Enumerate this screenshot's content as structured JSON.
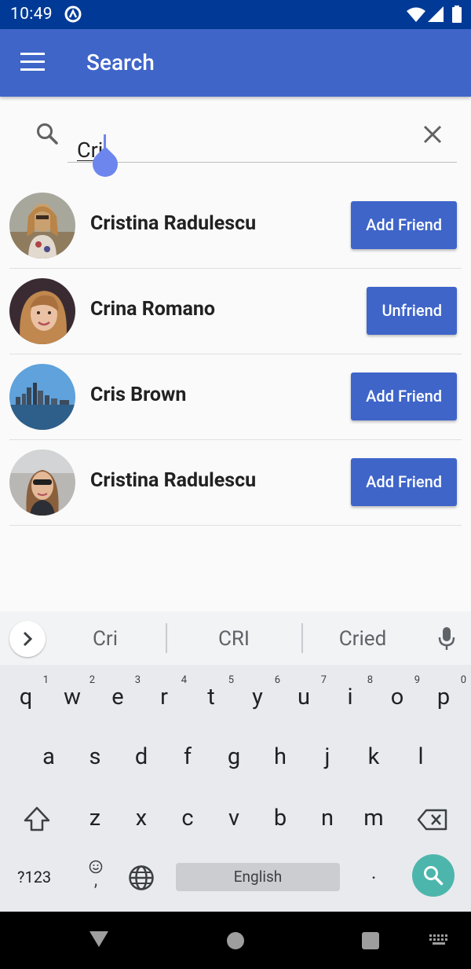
{
  "status_bar": {
    "time": "10:49"
  },
  "app_bar": {
    "title": "Search"
  },
  "search": {
    "value": "Cri"
  },
  "results": [
    {
      "name": "Cristina Radulescu",
      "action": "Add Friend"
    },
    {
      "name": "Crina Romano",
      "action": "Unfriend"
    },
    {
      "name": "Cris Brown",
      "action": "Add Friend"
    },
    {
      "name": "Cristina Radulescu",
      "action": "Add Friend"
    }
  ],
  "keyboard": {
    "suggestions": [
      "Cri",
      "CRI",
      "Cried"
    ],
    "row1": [
      {
        "k": "q",
        "n": "1"
      },
      {
        "k": "w",
        "n": "2"
      },
      {
        "k": "e",
        "n": "3"
      },
      {
        "k": "r",
        "n": "4"
      },
      {
        "k": "t",
        "n": "5"
      },
      {
        "k": "y",
        "n": "6"
      },
      {
        "k": "u",
        "n": "7"
      },
      {
        "k": "i",
        "n": "8"
      },
      {
        "k": "o",
        "n": "9"
      },
      {
        "k": "p",
        "n": "0"
      }
    ],
    "row2": [
      "a",
      "s",
      "d",
      "f",
      "g",
      "h",
      "j",
      "k",
      "l"
    ],
    "row3": [
      "z",
      "x",
      "c",
      "v",
      "b",
      "n",
      "m"
    ],
    "symbols_label": "?123",
    "comma_label": ",",
    "space_label": "English",
    "period_label": "."
  },
  "colors": {
    "status_bar": "#003a96",
    "app_bar": "#3f65c9",
    "button": "#3f65c9",
    "search_key": "#4db6ac"
  }
}
